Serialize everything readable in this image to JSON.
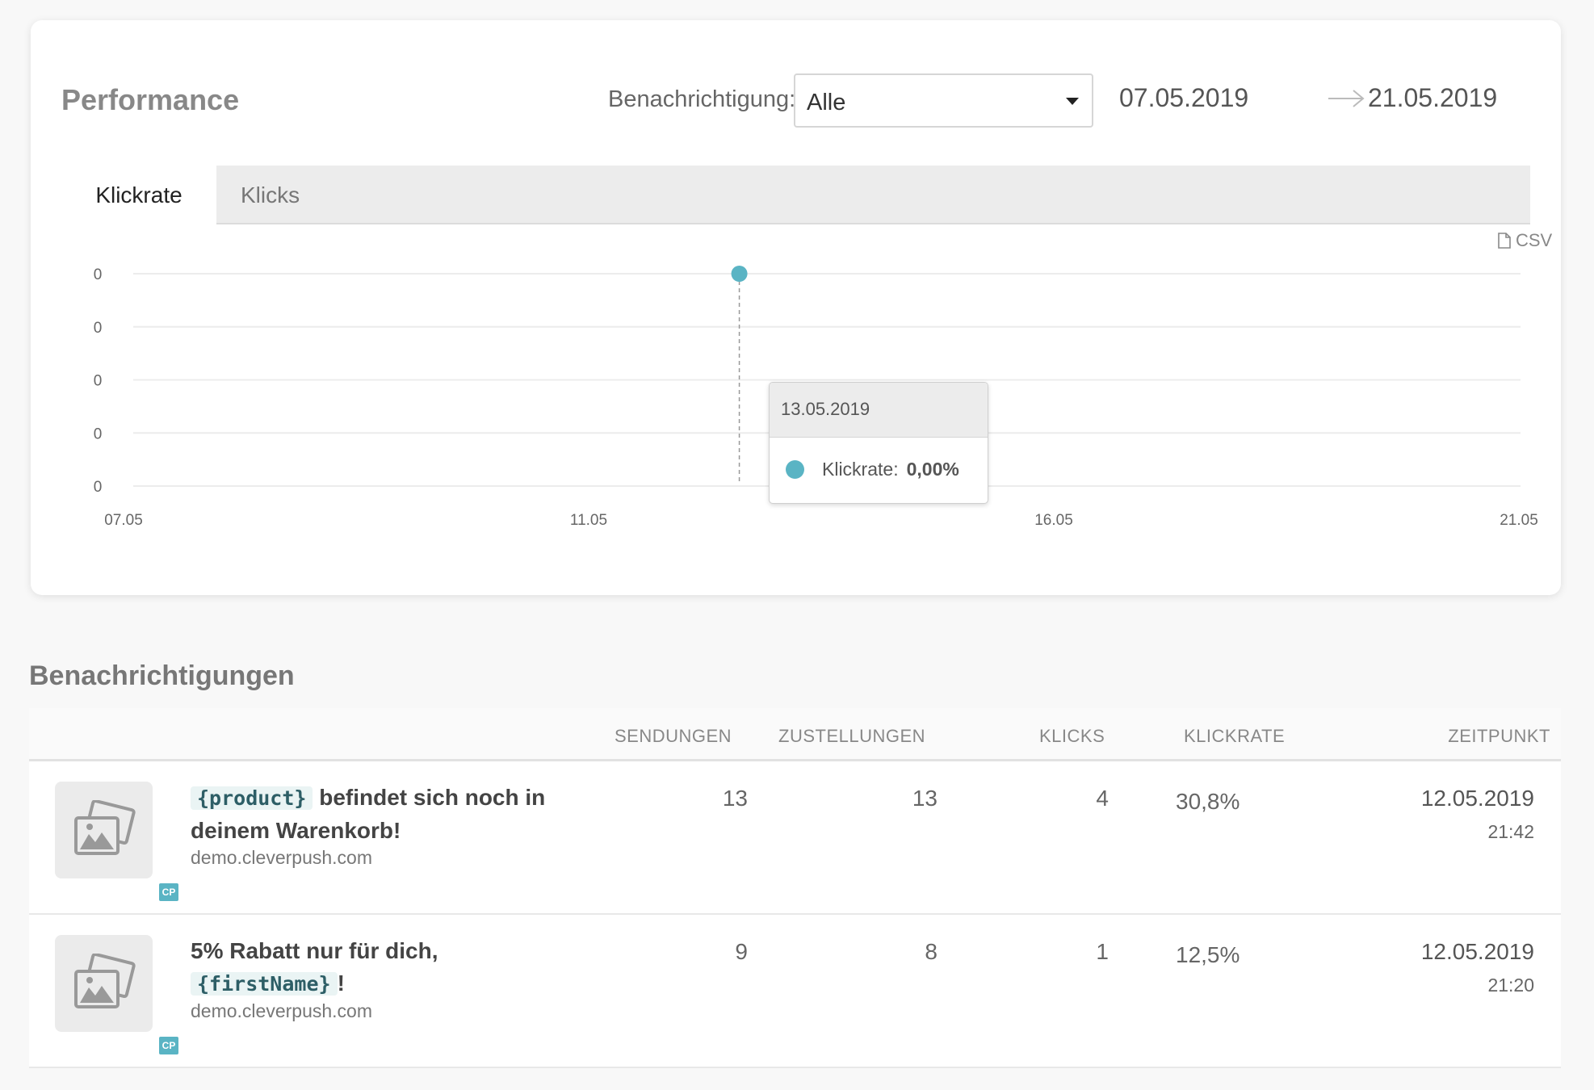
{
  "performance": {
    "title": "Performance",
    "filter_label": "Benachrichtigung:",
    "filter_value": "Alle",
    "date_from": "07.05.2019",
    "date_to": "21.05.2019",
    "tabs": [
      {
        "label": "Klickrate"
      },
      {
        "label": "Klicks"
      }
    ],
    "csv_label": "CSV"
  },
  "chart_data": {
    "type": "line",
    "x_ticks": [
      "07.05",
      "11.05",
      "16.05",
      "21.05"
    ],
    "y_ticks": [
      "0",
      "0",
      "0",
      "0",
      "0"
    ],
    "series": [
      {
        "name": "Klickrate",
        "points": [
          {
            "x": "13.05.2019",
            "y": 0
          }
        ]
      }
    ],
    "series_color": "#5ab4c4",
    "grid": true
  },
  "tooltip": {
    "date": "13.05.2019",
    "label": "Klickrate:",
    "value": "0,00%"
  },
  "notifications": {
    "title": "Benachrichtigungen",
    "columns": [
      "SENDUNGEN",
      "ZUSTELLUNGEN",
      "KLICKS",
      "KLICKRATE",
      "ZEITPUNKT"
    ],
    "rows": [
      {
        "title_code": "{product}",
        "title_text": " befindet sich noch in deinem Warenkorb!",
        "domain": "demo.cleverpush.com",
        "sendungen": "13",
        "zustellungen": "13",
        "klicks": "4",
        "klickrate": "30,8%",
        "date": "12.05.2019",
        "time": "21:42",
        "badge": "CP"
      },
      {
        "title_text_pre": "5% Rabatt nur für dich, ",
        "title_code": "{firstName}",
        "title_text_post": "!",
        "domain": "demo.cleverpush.com",
        "sendungen": "9",
        "zustellungen": "8",
        "klicks": "1",
        "klickrate": "12,5%",
        "date": "12.05.2019",
        "time": "21:20",
        "badge": "CP"
      }
    ]
  }
}
